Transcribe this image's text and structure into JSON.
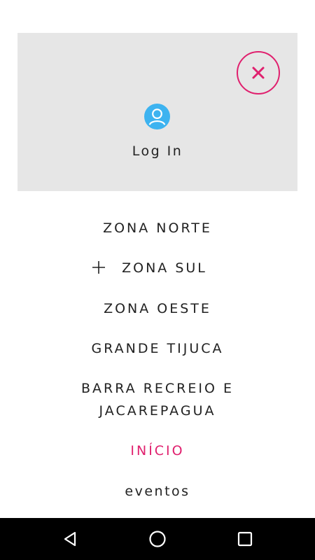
{
  "login": {
    "label": "Log In",
    "avatar_icon": "user-circle-icon",
    "close_icon": "close-icon"
  },
  "menu": {
    "items": [
      {
        "label": "ZONA NORTE"
      },
      {
        "label": "ZONA SUL",
        "expand_icon": "plus-icon"
      },
      {
        "label": "ZONA OESTE"
      },
      {
        "label": "GRANDE TIJUCA"
      },
      {
        "label_line1": "BARRA RECREIO E",
        "label_line2": "JACAREPAGUA"
      },
      {
        "label": "INÍCIO",
        "active": true
      },
      {
        "label": "eventos"
      }
    ]
  },
  "colors": {
    "accent": "#e0206e",
    "avatar": "#3db3f0",
    "panel": "#e6e6e6",
    "text": "#222222"
  },
  "navbar": {
    "back_icon": "back-triangle-icon",
    "home_icon": "home-circle-icon",
    "recents_icon": "recents-square-icon"
  }
}
